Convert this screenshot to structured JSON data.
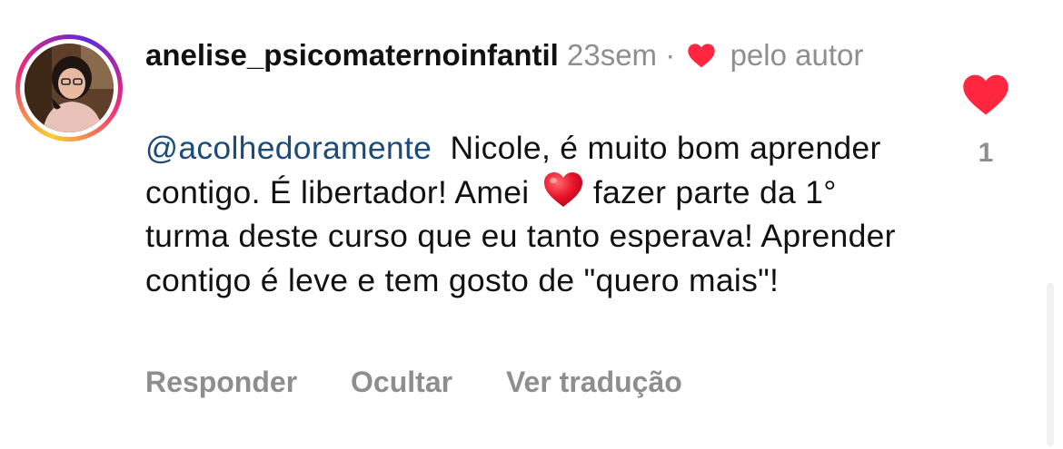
{
  "comment": {
    "username": "anelise_psicomaternoinfantil",
    "time": "23sem",
    "separator": "·",
    "liked_by_label": "pelo autor",
    "mention": "@acolhedoramente",
    "text_part1": "Nicole, é muito bom aprender contigo. É libertador! Amei",
    "text_part2": "fazer parte da 1° turma deste curso que eu tanto esperava!  Aprender contigo é leve e tem gosto de \"quero mais\"!",
    "emoji": "red-heart-emoji"
  },
  "actions": {
    "reply": "Responder",
    "hide": "Ocultar",
    "translate": "Ver tradução"
  },
  "like": {
    "count": "1",
    "liked": true,
    "color": "#ff2740"
  },
  "colors": {
    "mention": "#1c4b79",
    "muted": "#8e8e8e",
    "heart": "#ff2740"
  }
}
